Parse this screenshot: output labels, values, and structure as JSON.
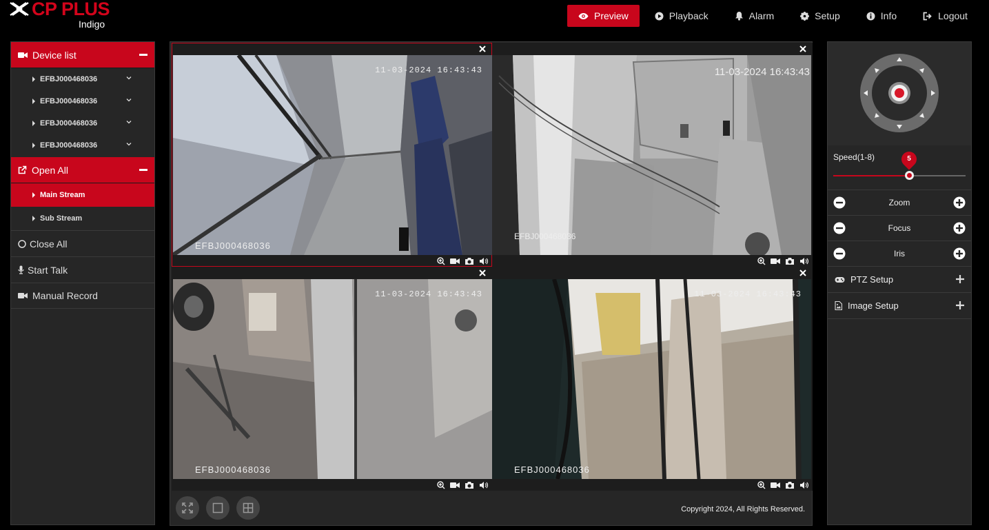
{
  "brand": {
    "name": "CP PLUS",
    "sub": "Indigo"
  },
  "nav": [
    {
      "label": "Preview",
      "icon": "eye-icon",
      "active": true
    },
    {
      "label": "Playback",
      "icon": "play-circle-icon"
    },
    {
      "label": "Alarm",
      "icon": "bell-icon"
    },
    {
      "label": "Setup",
      "icon": "gear-icon"
    },
    {
      "label": "Info",
      "icon": "info-icon"
    },
    {
      "label": "Logout",
      "icon": "logout-icon"
    }
  ],
  "sidebar": {
    "device_list": "Device list",
    "devices": [
      "EFBJ000468036",
      "EFBJ000468036",
      "EFBJ000468036",
      "EFBJ000468036"
    ],
    "open_all": "Open All",
    "streams": [
      {
        "label": "Main Stream",
        "active": true
      },
      {
        "label": "Sub Stream",
        "active": false
      }
    ],
    "close_all": "Close All",
    "start_talk": "Start Talk",
    "manual_record": "Manual Record"
  },
  "panes": [
    {
      "timestamp": "11-03-2024 16:43:43",
      "label": "EFBJ000468036",
      "selected": true
    },
    {
      "timestamp": "11-03-2024 16:43:43",
      "label": "EFBJ000468036",
      "selected": false
    },
    {
      "timestamp": "11-03-2024 16:43:43",
      "label": "EFBJ000468036",
      "selected": false
    },
    {
      "timestamp": "11-03-2024 16:43:43",
      "label": "EFBJ000468036",
      "selected": false
    }
  ],
  "copyright": "Copyright 2024, All Rights Reserved.",
  "ptz": {
    "speed_label": "Speed(1-8)",
    "speed_value": "5",
    "speed_level": 5,
    "speed_max": 8,
    "zoom": "Zoom",
    "focus": "Focus",
    "iris": "Iris",
    "ptz_setup": "PTZ Setup",
    "image_setup": "Image Setup"
  },
  "colors": {
    "accent": "#c8061c"
  }
}
